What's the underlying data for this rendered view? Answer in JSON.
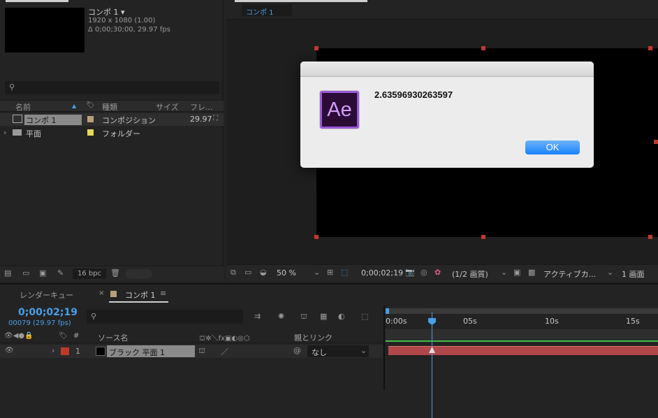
{
  "project": {
    "comp_name": "コンポ 1 ▾",
    "comp_res": "1920 x 1080 (1.00)",
    "comp_dur": "Δ 0;00;30;00, 29.97 fps",
    "columns": [
      "名前",
      "種類",
      "サイズ",
      "フレ..."
    ],
    "items": [
      {
        "name": "コンポ 1",
        "type": "コンポジション",
        "fps": "29.97",
        "color": "#b9a07a"
      },
      {
        "name": "平面",
        "type": "フォルダー",
        "fps": "",
        "color": "#e4d85c"
      }
    ],
    "bpc": "16 bpc"
  },
  "viewer": {
    "tab": "コンポ 1",
    "zoom": "50 %",
    "timecode": "0;00;02;19",
    "resolution": "(1/2 画質)",
    "camera": "アクティブカ...",
    "views": "1 画面"
  },
  "dialog": {
    "message": "2.63596930263597",
    "icon_text": "Ae",
    "ok": "OK"
  },
  "timeline": {
    "tab_render": "レンダーキュー",
    "tab_comp": "コンポ 1",
    "timecode": "0;00;02;19",
    "frames": "00079 (29.97 fps)",
    "hdr_source": "ソース名",
    "hdr_parent": "親とリンク",
    "layer_num": "1",
    "layer_name": "ブラック 平面 1",
    "parent_value": "なし",
    "ruler": [
      "0:00s",
      "05s",
      "10s",
      "15s"
    ]
  }
}
